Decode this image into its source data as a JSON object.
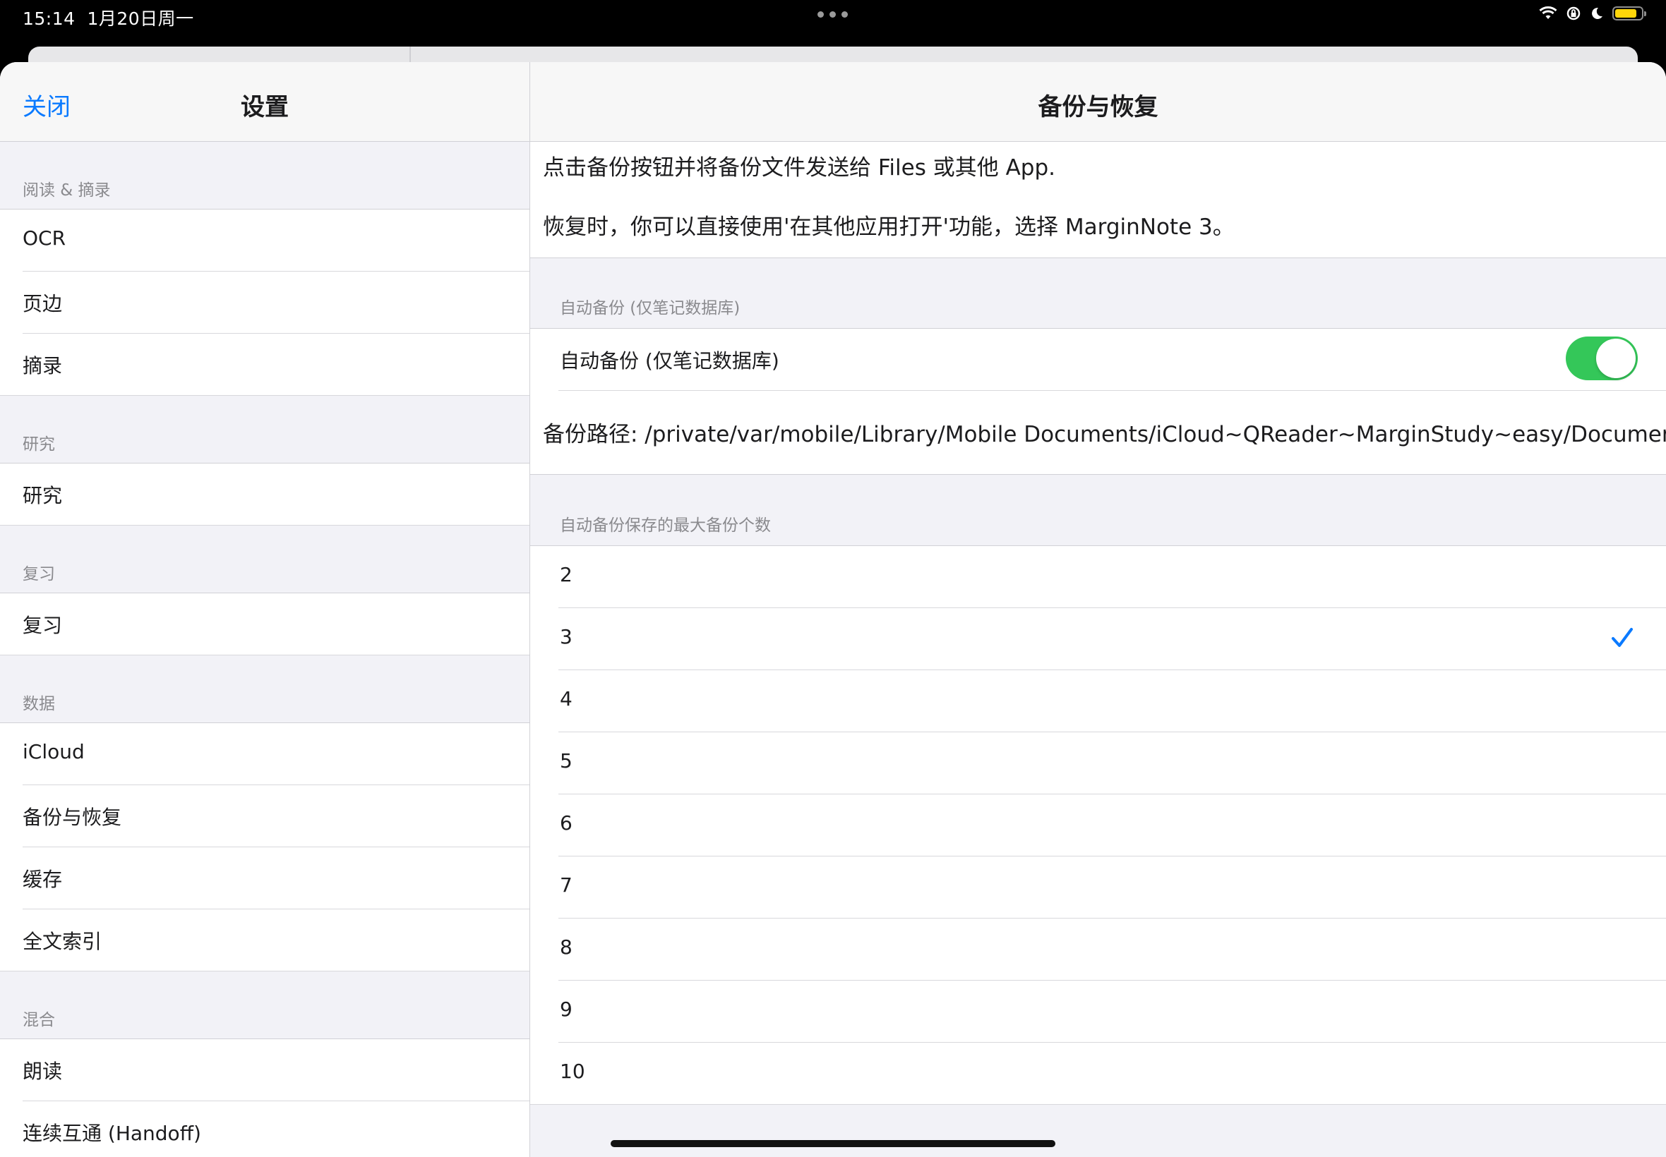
{
  "status_bar": {
    "time": "15:14",
    "date": "1月20日周一",
    "battery_color": "#ffd60a"
  },
  "sidebar": {
    "close_label": "关闭",
    "title": "设置",
    "groups": [
      {
        "header": "阅读 & 摘录",
        "items": [
          "OCR",
          "页边",
          "摘录"
        ]
      },
      {
        "header": "研究",
        "items": [
          "研究"
        ]
      },
      {
        "header": "复习",
        "items": [
          "复习"
        ]
      },
      {
        "header": "数据",
        "items": [
          "iCloud",
          "备份与恢复",
          "缓存",
          "全文索引"
        ]
      },
      {
        "header": "混合",
        "items": [
          "朗读",
          "连续互通 (Handoff)"
        ]
      }
    ]
  },
  "detail": {
    "title": "备份与恢复",
    "description": [
      "点击备份按钮并将备份文件发送给 Files 或其他 App.",
      "恢复时，你可以直接使用'在其他应用打开'功能，选择 MarginNote 3。"
    ],
    "auto_backup": {
      "header": "自动备份 (仅笔记数据库)",
      "toggle_label": "自动备份 (仅笔记数据库)",
      "enabled": true,
      "toggle_color": "#34c759"
    },
    "backup_path": "备份路径: /private/var/mobile/Library/Mobile Documents/iCloud~QReader~MarginStudy~easy/Documents",
    "max_backups": {
      "header": "自动备份保存的最大备份个数",
      "options": [
        "2",
        "3",
        "4",
        "5",
        "6",
        "7",
        "8",
        "9",
        "10"
      ],
      "selected": "3",
      "check_color": "#0a7aff"
    }
  }
}
